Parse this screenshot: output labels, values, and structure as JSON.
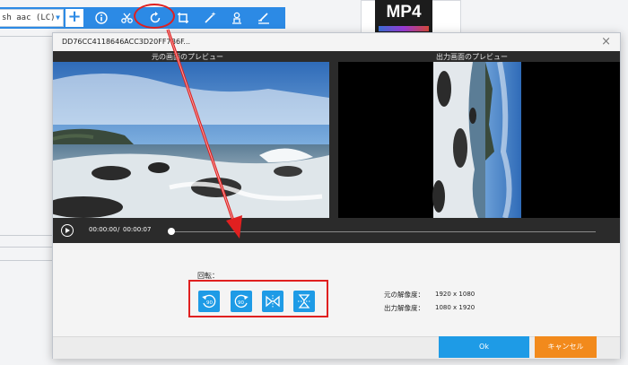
{
  "background_app": {
    "codec_select": "sh aac (LC)",
    "codec_arrow": "▼",
    "add_button": "+",
    "mp4_thumbnail": "MP4"
  },
  "dialog": {
    "title": "DD76CC4118646ACC3D20FF7B6F...",
    "close_glyph": "×",
    "preview": {
      "original_label": "元の画面のプレビュー",
      "output_label": "出力画面のプレビュー"
    },
    "playback": {
      "current_time": "00:00:00",
      "separator": "/",
      "total_time": "00:00:07",
      "progress": 0
    },
    "rotation": {
      "label": "回転：",
      "buttons": [
        {
          "icon": "rotate-left-90-icon",
          "text": "90"
        },
        {
          "icon": "rotate-right-90-icon",
          "text": "90"
        },
        {
          "icon": "flip-horizontal-icon"
        },
        {
          "icon": "flip-vertical-icon"
        }
      ]
    },
    "resolution": {
      "original_label": "元の解像度：",
      "original_value": "1920 x 1080",
      "output_label": "出力解像度：",
      "output_value": "1080 x 1920"
    },
    "ok_label": "Ok",
    "cancel_label": "キャンセル"
  },
  "colors": {
    "accent": "#1e9be6",
    "toolbar": "#2c8ae5",
    "cancel": "#f28a1c",
    "highlight": "#e02020"
  }
}
